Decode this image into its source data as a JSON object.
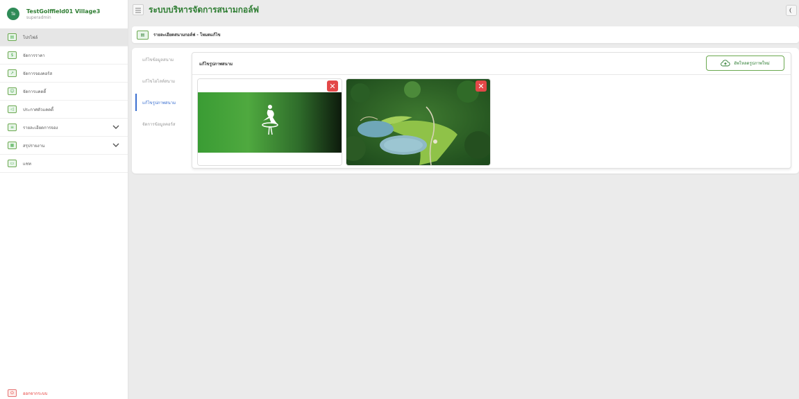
{
  "user": {
    "initials": "Te",
    "name": "TestGolffield01 Village3",
    "role": "superadmin"
  },
  "header": {
    "title": "ระบบบริหารจัดการสนามกอล์ฟ"
  },
  "sidebar": {
    "items": [
      {
        "label": "โปรไฟล์",
        "icon": "profile-card-icon"
      },
      {
        "label": "จัดการราคา",
        "icon": "coin-icon"
      },
      {
        "label": "จัดการจองคอร์ส",
        "icon": "chart-icon"
      },
      {
        "label": "จัดการแคดดี้",
        "icon": "group-icon"
      },
      {
        "label": "ประกาศตัวแคดดี้",
        "icon": "megaphone-icon"
      },
      {
        "label": "รายละเอียดการจอง",
        "icon": "list-icon"
      },
      {
        "label": "สรุปรายงาน",
        "icon": "report-icon"
      },
      {
        "label": "แชท",
        "icon": "chat-icon"
      }
    ],
    "logout_label": "ออกจากระบบ"
  },
  "breadcrumb": {
    "text": "รายละเอียดสนามกอล์ฟ - โหมดแก้ไข"
  },
  "subnav": {
    "items": [
      {
        "label": "แก้ไขข้อมูลสนาม"
      },
      {
        "label": "แก้ไขไฮไลท์สนาม"
      },
      {
        "label": "แก้ไขรูปภาพสนาม"
      },
      {
        "label": "จัดการข้อมูลคอร์ส"
      }
    ]
  },
  "panel": {
    "title": "แก้ไขรูปภาพสนาม",
    "upload_label": "อัพโหลดรูปภาพใหม่"
  },
  "colors": {
    "brand_green": "#2e7d32",
    "active_blue": "#3a6fd0",
    "danger_red": "#e34848",
    "logout_red": "#e53935"
  }
}
